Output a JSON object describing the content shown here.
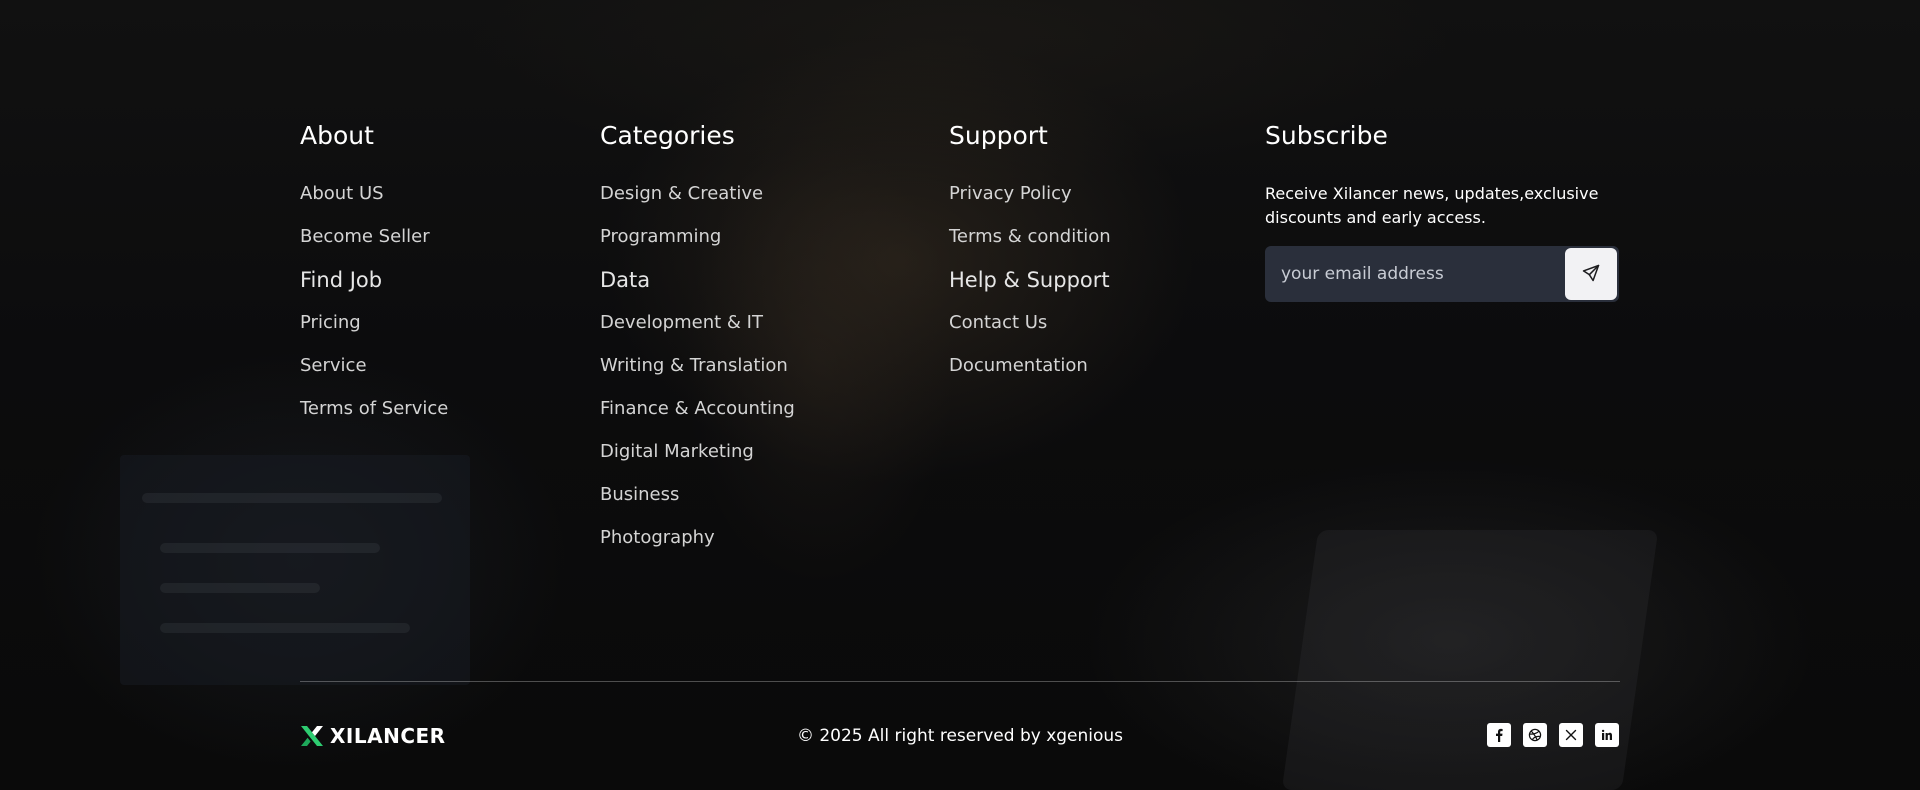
{
  "about": {
    "heading": "About",
    "links": [
      "About US",
      "Become Seller",
      "Find Job",
      "Pricing",
      "Service",
      "Terms of Service"
    ]
  },
  "categories": {
    "heading": "Categories",
    "links": [
      "Design & Creative",
      "Programming",
      "Data",
      "Development & IT",
      "Writing & Translation",
      "Finance & Accounting",
      "Digital Marketing",
      "Business",
      "Photography"
    ]
  },
  "support": {
    "heading": "Support",
    "links": [
      "Privacy Policy",
      "Terms & condition",
      "Help & Support",
      "Contact Us",
      "Documentation"
    ]
  },
  "subscribe": {
    "heading": "Subscribe",
    "description": "Receive Xilancer news, updates,exclusive discounts and early access.",
    "email_placeholder": "your email address",
    "submit_icon": "send-icon"
  },
  "bottom_bar": {
    "logo_text": "XILANCER",
    "copyright": "© 2025 All right reserved by xgenious",
    "socials": [
      "facebook-icon",
      "dribbble-icon",
      "x-icon",
      "linkedin-icon"
    ]
  },
  "colors": {
    "logo_green": "#2ecc71",
    "input_bg": "#2a2f3b",
    "link_text": "#d4d4d4"
  }
}
